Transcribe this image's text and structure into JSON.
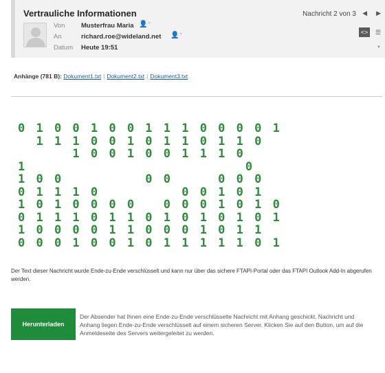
{
  "header": {
    "subject": "Vertrauliche Informationen",
    "message_position": "Nachricht 2 von 3",
    "from_label": "Von",
    "from_value": "Musterfrau Maria",
    "to_label": "An",
    "to_value": "richard.roe@wideland.net",
    "date_label": "Datum",
    "date_value": "Heute 19:51"
  },
  "attachments": {
    "label": "Anhänge (781 B):",
    "files": [
      "Dokument1.txt",
      "Dokument2.txt",
      "Dokument3.txt"
    ]
  },
  "binary_art": {
    "color": "#2e8b3a",
    "rows": [
      "0 1 0 0 1 0 0 1 1 1 0 0 0 0 1",
      "  1 1 1 0 0 1 0 1 1 0 1 1 0  ",
      "      1 0 0 1 0 0 1 1 1 0    ",
      "1                        0",
      "1 0 0         0 0     0 0 0",
      "0 1 1 1 0         0 0 1 0 1",
      "1 0 1 0 0 0 0   0 0 0 1 0 1 0",
      "0 1 1 1 0 1 1 0 1 0 1 0 1 0 1",
      "1 0 0 0 0 1 1 0 0 0 1 0 1 1",
      "0 0 0 1 0 0 1 0 1 1 1 1 1 0 1"
    ]
  },
  "notice_text": "Der Text dieser Nachricht wurde Ende-zu-Ende verschlüsselt und kann nur über das sichere FTAPI-Portal oder das FTAPI Outlook Add-In abgerufen werden.",
  "download": {
    "button_label": "Herunterladen",
    "description": "Der Absender hat Ihnen eine Ende-zu-Ende verschlüsselte Nachricht mit Anhang geschickt. Nachricht und Anhang liegen Ende-zu-Ende verschlüsselt auf einem sicheren Server. Klicken Sie auf den Button, um auf die Anmeldeseite des Servers weitergeleitet zu werden.",
    "button_color": "#1e8c3a"
  }
}
